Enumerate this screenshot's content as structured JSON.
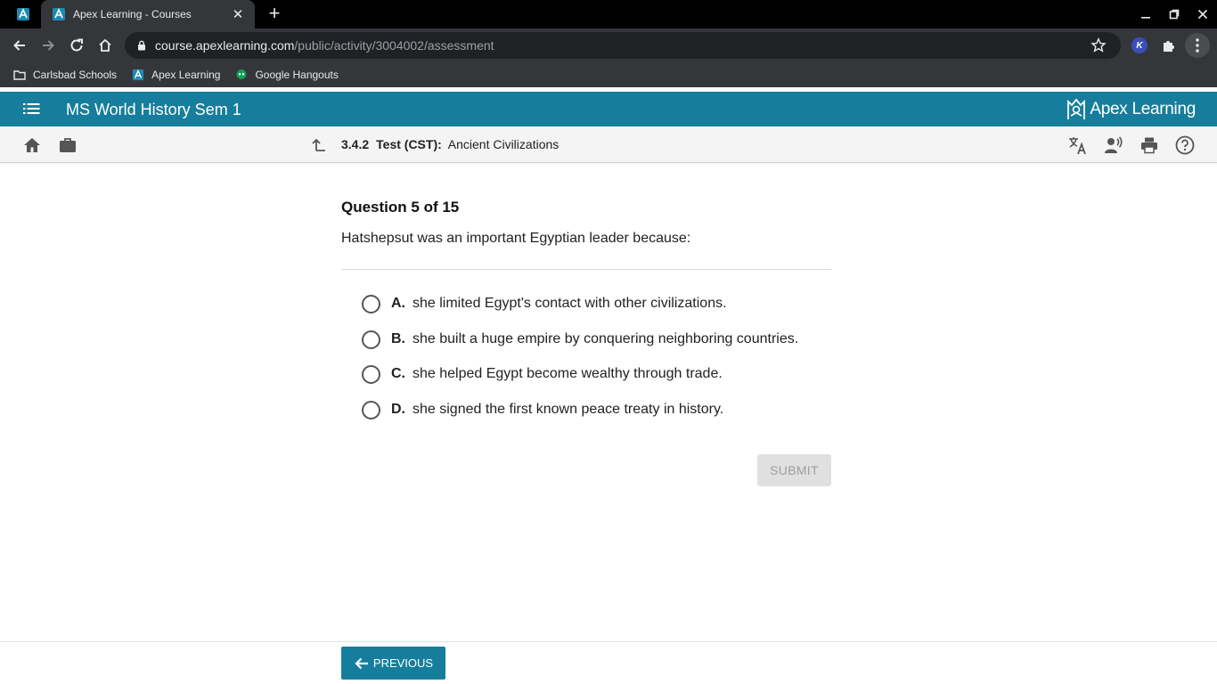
{
  "browser": {
    "tab_title": "Apex Learning - Courses",
    "url_host": "course.apexlearning.com",
    "url_path": "/public/activity/3004002/assessment",
    "bookmarks": [
      {
        "label": "Carlsbad Schools",
        "icon": "folder-icon"
      },
      {
        "label": "Apex Learning",
        "icon": "apex-favicon-icon"
      },
      {
        "label": "Google Hangouts",
        "icon": "hangouts-icon"
      }
    ],
    "extension_letter": "K"
  },
  "app": {
    "course_title": "MS World History Sem 1",
    "brand_name": "Apex Learning",
    "accent_color": "#167e9c"
  },
  "activity": {
    "number": "3.4.2",
    "type": "Test (CST):",
    "name": "Ancient Civilizations"
  },
  "question": {
    "heading": "Question 5 of 15",
    "prompt": "Hatshepsut was an important Egyptian leader because:",
    "answers": [
      {
        "letter": "A.",
        "text": "she limited Egypt's contact with other civilizations."
      },
      {
        "letter": "B.",
        "text": "she built a huge empire by conquering neighboring countries."
      },
      {
        "letter": "C.",
        "text": "she helped Egypt become wealthy through trade."
      },
      {
        "letter": "D.",
        "text": "she signed the first known peace treaty in history."
      }
    ],
    "submit_label": "SUBMIT"
  },
  "footer": {
    "previous_label": "PREVIOUS"
  }
}
